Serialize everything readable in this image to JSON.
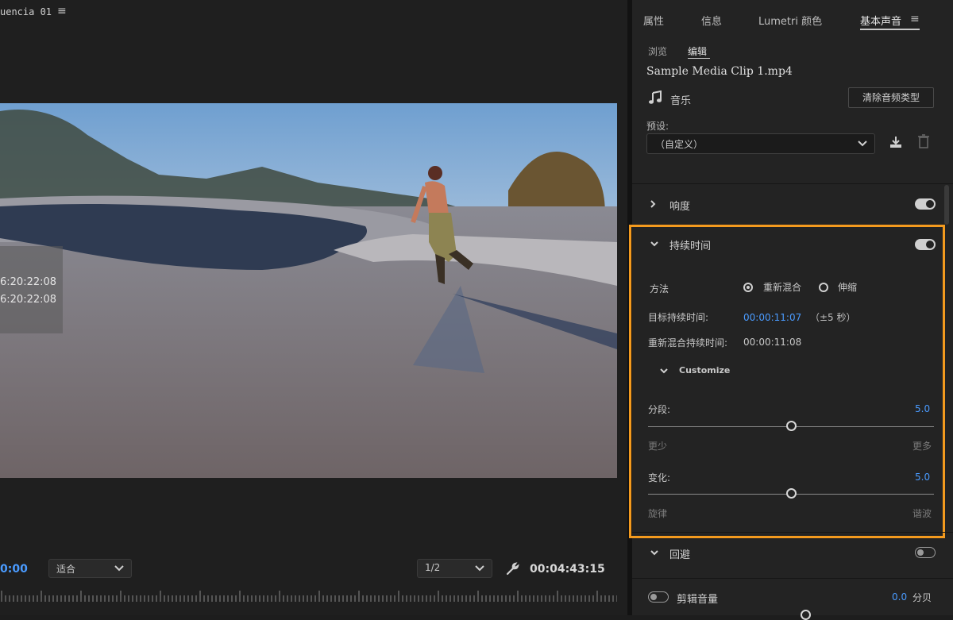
{
  "monitor": {
    "sequence_title": "uencia 01",
    "timecode_overlay": [
      "6:20:22:08",
      "6:20:22:08"
    ],
    "playhead_timecode": "0:00",
    "fit_dropdown": "适合",
    "resolution_dropdown": "1/2",
    "duration_timecode": "00:04:43:15"
  },
  "panel": {
    "tabs": [
      "属性",
      "信息",
      "Lumetri 颜色",
      "基本声音"
    ],
    "active_tab": "基本声音",
    "subtabs": [
      "浏览",
      "编辑"
    ],
    "active_subtab": "编辑",
    "clip_name": "Sample Media Clip 1.mp4",
    "audio_type_label": "音乐",
    "clear_button": "清除音频类型",
    "preset": {
      "label": "预设:",
      "value": "（自定义）"
    },
    "loudness": {
      "title": "响度",
      "enabled": true
    },
    "duration": {
      "title": "持续时间",
      "enabled": true,
      "method_label": "方法",
      "options": [
        "重新混合",
        "伸缩"
      ],
      "selected_option": "重新混合",
      "target_label": "目标持续时间:",
      "target_value": "00:00:11:07",
      "target_tolerance": "（±5 秒）",
      "remix_label": "重新混合持续时间:",
      "remix_value": "00:00:11:08",
      "customize_label": "Customize",
      "segments": {
        "label": "分段:",
        "value": "5.0",
        "min_label": "更少",
        "max_label": "更多",
        "position": 0.5
      },
      "variation": {
        "label": "变化:",
        "value": "5.0",
        "min_label": "旋律",
        "max_label": "谐波",
        "position": 0.5
      }
    },
    "reverb": {
      "title": "回避",
      "enabled": false
    },
    "clip_volume": {
      "label": "剪辑音量",
      "value": "0.0",
      "unit": "分贝",
      "enabled": false
    }
  },
  "colors": {
    "accent_blue": "#4a9bff",
    "highlight_orange": "#f39a1e"
  }
}
